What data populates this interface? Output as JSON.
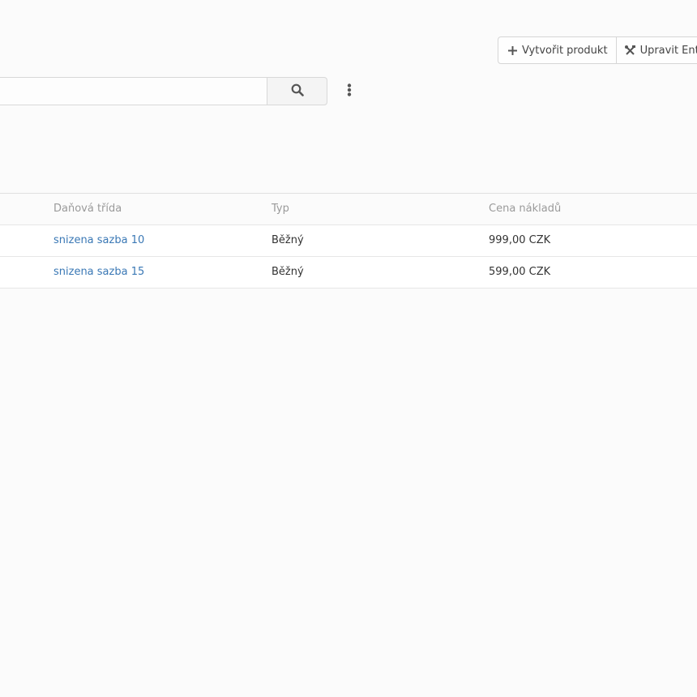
{
  "toolbar": {
    "create_product_label": "Vytvořit produkt",
    "edit_entity_label": "Upravit Ent"
  },
  "search": {
    "value": "",
    "placeholder": ""
  },
  "table": {
    "columns": [
      "Daňová třída",
      "Typ",
      "Cena nákladů"
    ],
    "rows": [
      {
        "tax_class": "snizena sazba 10",
        "type": "Běžný",
        "cost_price": "999,00 CZK"
      },
      {
        "tax_class": "snizena sazba 15",
        "type": "Běžný",
        "cost_price": "599,00 CZK"
      }
    ]
  },
  "icons": {
    "create": "plus-icon",
    "edit": "tools-icon",
    "search": "search-icon",
    "more": "more-vertical-icon"
  },
  "colors": {
    "link": "#3a78b5",
    "header_text": "#9a9a9a",
    "background": "#fbfbfb"
  }
}
